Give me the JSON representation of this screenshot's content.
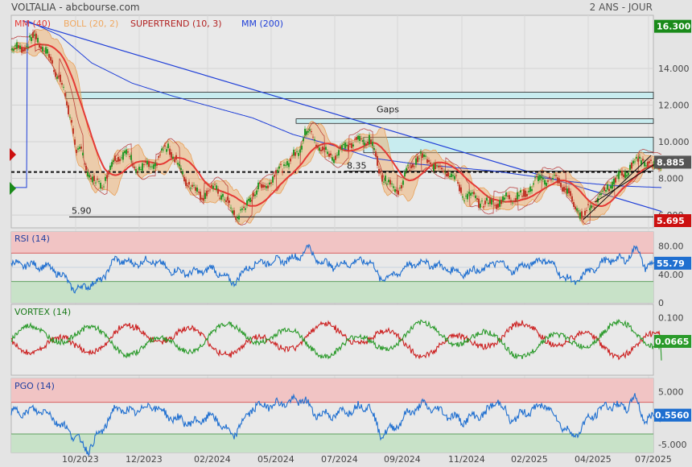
{
  "header": {
    "title": "VOLTALIA - abcbourse.com",
    "period": "2 ANS - JOUR"
  },
  "colors": {
    "price_up": "#2a9a2a",
    "price_down": "#c0392b",
    "mm40": "#e53935",
    "boll": "#f0a860",
    "supertrend": "#b22222",
    "mm200": "#1f3fd8",
    "rsi": "#1f6fd0",
    "vortex_plus": "#2a9a2a",
    "vortex_minus": "#cc2020",
    "pgo": "#1f6fd0",
    "overbought_zone": "#f1c4c4",
    "oversold_zone": "#c8e2c8",
    "gap_zone": "#c8ecef"
  },
  "chart_data": [
    {
      "type": "line",
      "name": "price",
      "legend": [
        "MM (40)",
        "BOLL (20, 2)",
        "SUPERTREND (10, 3)",
        "MM (200)"
      ],
      "x_labels": [
        "10/2023",
        "12/2023",
        "02/2024",
        "05/2024",
        "07/2024",
        "09/2024",
        "11/2024",
        "02/2025",
        "04/2025",
        "07/2025"
      ],
      "ylim": [
        5.3,
        16.9
      ],
      "yticks": [
        6.0,
        8.0,
        10.0,
        12.0,
        14.0
      ],
      "ytick_labels": [
        "6.000",
        "8.000",
        "10.000",
        "12.000",
        "14.000"
      ],
      "close_anchors": [
        [
          0,
          15.0
        ],
        [
          20,
          15.3
        ],
        [
          30,
          15.8
        ],
        [
          45,
          14.7
        ],
        [
          60,
          13.5
        ],
        [
          75,
          11.0
        ],
        [
          80,
          9.6
        ],
        [
          85,
          9.6
        ],
        [
          95,
          8.3
        ],
        [
          110,
          7.5
        ],
        [
          125,
          8.8
        ],
        [
          140,
          9.5
        ],
        [
          155,
          8.6
        ],
        [
          175,
          8.6
        ],
        [
          195,
          9.8
        ],
        [
          205,
          8.9
        ],
        [
          215,
          8.0
        ],
        [
          235,
          7.1
        ],
        [
          255,
          7.5
        ],
        [
          270,
          6.5
        ],
        [
          280,
          5.95
        ],
        [
          290,
          6.3
        ],
        [
          300,
          7.2
        ],
        [
          320,
          7.8
        ],
        [
          335,
          8.6
        ],
        [
          345,
          8.9
        ],
        [
          355,
          9.4
        ],
        [
          365,
          10.5
        ],
        [
          372,
          10.6
        ],
        [
          380,
          9.8
        ],
        [
          390,
          9.4
        ],
        [
          400,
          9.2
        ],
        [
          415,
          9.8
        ],
        [
          430,
          10.0
        ],
        [
          445,
          10.2
        ],
        [
          458,
          8.4
        ],
        [
          470,
          7.7
        ],
        [
          480,
          7.3
        ],
        [
          490,
          8.2
        ],
        [
          505,
          9.2
        ],
        [
          515,
          9.0
        ],
        [
          530,
          8.6
        ],
        [
          545,
          8.4
        ],
        [
          560,
          7.2
        ],
        [
          575,
          6.9
        ],
        [
          590,
          6.6
        ],
        [
          605,
          6.7
        ],
        [
          620,
          7.0
        ],
        [
          635,
          7.0
        ],
        [
          650,
          7.8
        ],
        [
          665,
          8.0
        ],
        [
          680,
          7.9
        ],
        [
          690,
          7.3
        ],
        [
          700,
          6.5
        ],
        [
          711,
          5.9
        ],
        [
          720,
          6.5
        ],
        [
          740,
          7.5
        ],
        [
          760,
          8.2
        ],
        [
          775,
          8.9
        ],
        [
          785,
          9.1
        ],
        [
          795,
          8.6
        ],
        [
          808,
          8.85
        ]
      ],
      "mm200_anchors": [
        [
          20,
          16.6
        ],
        [
          60,
          15.8
        ],
        [
          100,
          14.3
        ],
        [
          150,
          13.2
        ],
        [
          200,
          12.5
        ],
        [
          250,
          11.9
        ],
        [
          300,
          11.3
        ],
        [
          350,
          10.4
        ],
        [
          400,
          9.8
        ],
        [
          450,
          9.1
        ],
        [
          500,
          8.8
        ],
        [
          550,
          8.6
        ],
        [
          600,
          8.4
        ],
        [
          650,
          8.1
        ],
        [
          700,
          7.8
        ],
        [
          750,
          7.6
        ],
        [
          808,
          7.5
        ]
      ],
      "trendline": [
        [
          14,
          16.6
        ],
        [
          808,
          6.2
        ]
      ],
      "gaps": [
        [
          12.7,
          12.35
        ],
        [
          11.25,
          11.0
        ],
        [
          10.25,
          9.4
        ]
      ],
      "gaps_label": "Gaps",
      "support_level": 5.9,
      "support_label": "5.90",
      "dotted_level": 8.35,
      "dotted_label": "8.35",
      "tags": [
        {
          "value": 16.3,
          "label": "16.300",
          "color": "#1a8a1a"
        },
        {
          "value": 8.885,
          "label": "8.885",
          "color": "#555555"
        },
        {
          "value": 5.695,
          "label": "5.695",
          "color": "#cc1010"
        }
      ]
    },
    {
      "type": "line",
      "name": "RSI (14)",
      "ylim": [
        0,
        100
      ],
      "yticks": [
        80,
        40,
        0
      ],
      "ytick_labels": [
        "80.00",
        "40.00",
        "0"
      ],
      "zones": {
        "upper": 70,
        "lower": 30
      },
      "anchors": [
        [
          0,
          55
        ],
        [
          40,
          52
        ],
        [
          60,
          42
        ],
        [
          80,
          18
        ],
        [
          95,
          25
        ],
        [
          110,
          30
        ],
        [
          130,
          62
        ],
        [
          150,
          55
        ],
        [
          175,
          60
        ],
        [
          200,
          45
        ],
        [
          225,
          42
        ],
        [
          250,
          48
        ],
        [
          275,
          28
        ],
        [
          300,
          55
        ],
        [
          320,
          58
        ],
        [
          340,
          60
        ],
        [
          360,
          66
        ],
        [
          368,
          80
        ],
        [
          380,
          60
        ],
        [
          400,
          52
        ],
        [
          430,
          58
        ],
        [
          445,
          60
        ],
        [
          458,
          35
        ],
        [
          475,
          38
        ],
        [
          490,
          50
        ],
        [
          510,
          58
        ],
        [
          530,
          52
        ],
        [
          560,
          42
        ],
        [
          590,
          48
        ],
        [
          605,
          60
        ],
        [
          620,
          45
        ],
        [
          645,
          55
        ],
        [
          665,
          62
        ],
        [
          685,
          38
        ],
        [
          700,
          28
        ],
        [
          715,
          42
        ],
        [
          740,
          60
        ],
        [
          765,
          62
        ],
        [
          778,
          78
        ],
        [
          788,
          50
        ],
        [
          800,
          55
        ],
        [
          808,
          55.79
        ]
      ],
      "current": "55.79"
    },
    {
      "type": "line",
      "name": "VORTEX (14)",
      "ylim": [
        -0.16,
        0.16
      ],
      "yticks": [
        0.1
      ],
      "ytick_labels": [
        "0.100"
      ],
      "current": "0.0665"
    },
    {
      "type": "line",
      "name": "PGO (14)",
      "ylim": [
        -6.5,
        7.5
      ],
      "yticks": [
        5.0,
        0,
        -5.0
      ],
      "ytick_labels": [
        "5.000",
        "0",
        "-5.000"
      ],
      "zones": {
        "upper": 3.0,
        "lower": -3.0
      },
      "anchors": [
        [
          0,
          1
        ],
        [
          40,
          1.5
        ],
        [
          60,
          -1
        ],
        [
          80,
          -3.5
        ],
        [
          95,
          -6
        ],
        [
          110,
          -3
        ],
        [
          130,
          2
        ],
        [
          150,
          1
        ],
        [
          175,
          2.5
        ],
        [
          200,
          0
        ],
        [
          225,
          -1
        ],
        [
          250,
          0.5
        ],
        [
          275,
          -3.5
        ],
        [
          300,
          2
        ],
        [
          320,
          2.5
        ],
        [
          345,
          3
        ],
        [
          365,
          3.5
        ],
        [
          375,
          1
        ],
        [
          400,
          0.5
        ],
        [
          430,
          2
        ],
        [
          445,
          2.5
        ],
        [
          458,
          -3
        ],
        [
          475,
          -2
        ],
        [
          490,
          0.5
        ],
        [
          510,
          2.5
        ],
        [
          530,
          1.5
        ],
        [
          560,
          -0.5
        ],
        [
          590,
          1
        ],
        [
          605,
          3.5
        ],
        [
          620,
          -0.5
        ],
        [
          645,
          1.5
        ],
        [
          665,
          2.5
        ],
        [
          685,
          -1.5
        ],
        [
          700,
          -3.5
        ],
        [
          715,
          -0.5
        ],
        [
          740,
          2.5
        ],
        [
          765,
          2
        ],
        [
          775,
          4
        ],
        [
          788,
          -0.5
        ],
        [
          800,
          0.3
        ],
        [
          808,
          0.556
        ]
      ],
      "current": "0.5560"
    }
  ]
}
